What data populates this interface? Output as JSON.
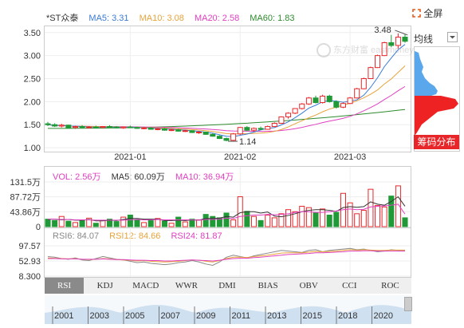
{
  "header": {
    "stock_name": "*ST众泰",
    "fullscreen_label": "全屏"
  },
  "legend_main": [
    {
      "label": "MA5: 3.31",
      "color": "#3a7bd5"
    },
    {
      "label": "MA10: 3.08",
      "color": "#e8a33a"
    },
    {
      "label": "MA20: 2.58",
      "color": "#e040c0"
    },
    {
      "label": "MA60: 1.83",
      "color": "#2e8b2e"
    }
  ],
  "legend_volume": [
    {
      "label": "VOL: 2.56万",
      "color": "#e040c0"
    },
    {
      "label": "MA5: 60.09万",
      "color": "#333333"
    },
    {
      "label": "MA10: 36.94万",
      "color": "#e040c0"
    }
  ],
  "legend_rsi": [
    {
      "label": "RSI6: 84.07",
      "color": "#888888"
    },
    {
      "label": "RSI12: 84.66",
      "color": "#e8a33a"
    },
    {
      "label": "RSI24: 81.87",
      "color": "#e040c0"
    }
  ],
  "right_panel": {
    "junxian_label": "均线",
    "chip_label": "筹码分布"
  },
  "watermark": "东方财富 eastmoney.com",
  "tabs": [
    "RSI",
    "KDJ",
    "MACD",
    "WWR",
    "DMI",
    "BIAS",
    "OBV",
    "CCI",
    "ROC"
  ],
  "active_tab": "RSI",
  "overview_years": [
    "2001",
    "2003",
    "2005",
    "2007",
    "2009",
    "2011",
    "2013",
    "2015",
    "2018",
    "2020"
  ],
  "colors": {
    "up": "#e8262a",
    "down": "#1f9a37",
    "ma5": "#3a7bd5",
    "ma10": "#e8a33a",
    "ma20": "#e040c0",
    "ma60": "#2e8b2e"
  },
  "chart_data": [
    {
      "type": "candlestick",
      "title": "*ST众泰",
      "y_ticks": [
        "3.50",
        "3.00",
        "2.50",
        "2.00",
        "1.50",
        "1.00"
      ],
      "ylim": [
        0.95,
        3.6
      ],
      "x_ticks": [
        "2021-01",
        "2021-02",
        "2021-03"
      ],
      "annotations": [
        "3.48",
        "1.14"
      ],
      "candles": [
        {
          "o": 1.52,
          "h": 1.56,
          "l": 1.47,
          "c": 1.5
        },
        {
          "o": 1.5,
          "h": 1.53,
          "l": 1.45,
          "c": 1.47
        },
        {
          "o": 1.47,
          "h": 1.52,
          "l": 1.44,
          "c": 1.49
        },
        {
          "o": 1.49,
          "h": 1.5,
          "l": 1.42,
          "c": 1.43
        },
        {
          "o": 1.44,
          "h": 1.48,
          "l": 1.41,
          "c": 1.46
        },
        {
          "o": 1.46,
          "h": 1.49,
          "l": 1.43,
          "c": 1.44
        },
        {
          "o": 1.44,
          "h": 1.47,
          "l": 1.42,
          "c": 1.45
        },
        {
          "o": 1.45,
          "h": 1.48,
          "l": 1.43,
          "c": 1.44
        },
        {
          "o": 1.44,
          "h": 1.47,
          "l": 1.42,
          "c": 1.46
        },
        {
          "o": 1.46,
          "h": 1.49,
          "l": 1.44,
          "c": 1.45
        },
        {
          "o": 1.45,
          "h": 1.47,
          "l": 1.42,
          "c": 1.43
        },
        {
          "o": 1.43,
          "h": 1.46,
          "l": 1.41,
          "c": 1.45
        },
        {
          "o": 1.45,
          "h": 1.48,
          "l": 1.43,
          "c": 1.44
        },
        {
          "o": 1.44,
          "h": 1.46,
          "l": 1.41,
          "c": 1.42
        },
        {
          "o": 1.42,
          "h": 1.45,
          "l": 1.4,
          "c": 1.43
        },
        {
          "o": 1.43,
          "h": 1.45,
          "l": 1.39,
          "c": 1.4
        },
        {
          "o": 1.4,
          "h": 1.43,
          "l": 1.38,
          "c": 1.41
        },
        {
          "o": 1.41,
          "h": 1.43,
          "l": 1.37,
          "c": 1.38
        },
        {
          "o": 1.38,
          "h": 1.41,
          "l": 1.36,
          "c": 1.39
        },
        {
          "o": 1.39,
          "h": 1.41,
          "l": 1.35,
          "c": 1.36
        },
        {
          "o": 1.36,
          "h": 1.39,
          "l": 1.34,
          "c": 1.37
        },
        {
          "o": 1.37,
          "h": 1.38,
          "l": 1.32,
          "c": 1.33
        },
        {
          "o": 1.33,
          "h": 1.36,
          "l": 1.3,
          "c": 1.34
        },
        {
          "o": 1.34,
          "h": 1.35,
          "l": 1.28,
          "c": 1.29
        },
        {
          "o": 1.29,
          "h": 1.31,
          "l": 1.24,
          "c": 1.25
        },
        {
          "o": 1.25,
          "h": 1.27,
          "l": 1.19,
          "c": 1.2
        },
        {
          "o": 1.2,
          "h": 1.22,
          "l": 1.14,
          "c": 1.16
        },
        {
          "o": 1.16,
          "h": 1.32,
          "l": 1.15,
          "c": 1.3
        },
        {
          "o": 1.3,
          "h": 1.45,
          "l": 1.28,
          "c": 1.44
        },
        {
          "o": 1.44,
          "h": 1.47,
          "l": 1.36,
          "c": 1.38
        },
        {
          "o": 1.38,
          "h": 1.44,
          "l": 1.35,
          "c": 1.42
        },
        {
          "o": 1.42,
          "h": 1.46,
          "l": 1.38,
          "c": 1.4
        },
        {
          "o": 1.4,
          "h": 1.48,
          "l": 1.39,
          "c": 1.46
        },
        {
          "o": 1.46,
          "h": 1.55,
          "l": 1.45,
          "c": 1.53
        },
        {
          "o": 1.53,
          "h": 1.68,
          "l": 1.52,
          "c": 1.67
        },
        {
          "o": 1.67,
          "h": 1.77,
          "l": 1.63,
          "c": 1.75
        },
        {
          "o": 1.75,
          "h": 1.86,
          "l": 1.73,
          "c": 1.85
        },
        {
          "o": 1.85,
          "h": 1.97,
          "l": 1.83,
          "c": 1.95
        },
        {
          "o": 1.95,
          "h": 2.1,
          "l": 1.93,
          "c": 2.08
        },
        {
          "o": 2.08,
          "h": 2.13,
          "l": 1.96,
          "c": 1.98
        },
        {
          "o": 1.98,
          "h": 2.15,
          "l": 1.96,
          "c": 2.12
        },
        {
          "o": 2.12,
          "h": 2.15,
          "l": 1.98,
          "c": 2.0
        },
        {
          "o": 2.0,
          "h": 2.03,
          "l": 1.85,
          "c": 1.88
        },
        {
          "o": 1.88,
          "h": 1.98,
          "l": 1.86,
          "c": 1.96
        },
        {
          "o": 1.96,
          "h": 2.1,
          "l": 1.95,
          "c": 2.08
        },
        {
          "o": 2.08,
          "h": 2.3,
          "l": 2.07,
          "c": 2.28
        },
        {
          "o": 2.28,
          "h": 2.52,
          "l": 2.27,
          "c": 2.5
        },
        {
          "o": 2.5,
          "h": 2.76,
          "l": 2.49,
          "c": 2.74
        },
        {
          "o": 2.74,
          "h": 3.02,
          "l": 2.73,
          "c": 3.0
        },
        {
          "o": 3.0,
          "h": 3.3,
          "l": 2.99,
          "c": 3.28
        },
        {
          "o": 3.28,
          "h": 3.45,
          "l": 3.18,
          "c": 3.22
        },
        {
          "o": 3.22,
          "h": 3.48,
          "l": 3.15,
          "c": 3.4
        },
        {
          "o": 3.4,
          "h": 3.46,
          "l": 3.28,
          "c": 3.31
        }
      ]
    },
    {
      "type": "bar",
      "title": "VOL",
      "y_ticks": [
        "131.5万",
        "87.72万",
        "43.86万",
        "0"
      ],
      "ylim": [
        0,
        131.5
      ],
      "values": [
        22,
        18,
        30,
        16,
        12,
        20,
        25,
        10,
        18,
        22,
        15,
        28,
        34,
        20,
        12,
        18,
        24,
        16,
        10,
        28,
        14,
        22,
        20,
        36,
        30,
        26,
        40,
        20,
        88,
        45,
        30,
        18,
        34,
        26,
        38,
        50,
        44,
        60,
        56,
        40,
        52,
        34,
        42,
        98,
        70,
        38,
        48,
        110,
        62,
        58,
        90,
        120,
        26
      ],
      "ma5": [
        22,
        22,
        20,
        21,
        19,
        19,
        21,
        17,
        17,
        19,
        18,
        21,
        24,
        24,
        22,
        22,
        22,
        18,
        18,
        19,
        18,
        20,
        19,
        24,
        24,
        25,
        30,
        28,
        41,
        44,
        44,
        40,
        43,
        31,
        29,
        33,
        38,
        44,
        48,
        50,
        50,
        48,
        45,
        56,
        59,
        57,
        59,
        73,
        66,
        63,
        74,
        88,
        60
      ],
      "ma10": [
        22,
        22,
        21,
        21,
        20,
        20,
        20,
        19,
        19,
        19,
        19,
        19,
        20,
        21,
        20,
        20,
        21,
        20,
        20,
        20,
        20,
        20,
        19,
        21,
        21,
        22,
        25,
        24,
        30,
        32,
        34,
        34,
        36,
        35,
        36,
        38,
        42,
        44,
        44,
        42,
        42,
        44,
        46,
        50,
        52,
        50,
        51,
        58,
        60,
        61,
        63,
        66,
        37
      ]
    },
    {
      "type": "line",
      "title": "RSI",
      "y_ticks": [
        "97.57",
        "52.93",
        "8.300"
      ],
      "ylim": [
        8.3,
        97.57
      ],
      "rsi6": [
        66,
        64,
        60,
        58,
        62,
        56,
        54,
        60,
        66,
        62,
        58,
        56,
        52,
        48,
        50,
        46,
        44,
        42,
        44,
        48,
        50,
        54,
        50,
        44,
        40,
        50,
        64,
        70,
        66,
        62,
        68,
        72,
        76,
        80,
        84,
        82,
        80,
        78,
        84,
        86,
        80,
        84,
        86,
        88,
        90,
        86,
        88,
        84,
        80,
        82,
        86,
        84,
        84
      ],
      "rsi12": [
        62,
        61,
        60,
        59,
        60,
        58,
        57,
        58,
        60,
        59,
        57,
        56,
        55,
        53,
        54,
        52,
        51,
        50,
        51,
        52,
        54,
        56,
        55,
        52,
        50,
        54,
        60,
        64,
        64,
        63,
        66,
        68,
        70,
        73,
        76,
        77,
        77,
        77,
        79,
        81,
        80,
        81,
        82,
        84,
        86,
        85,
        86,
        85,
        84,
        84,
        85,
        85,
        85
      ],
      "rsi24": [
        60,
        60,
        59,
        59,
        59,
        58,
        58,
        58,
        59,
        58,
        57,
        57,
        56,
        55,
        55,
        54,
        54,
        53,
        53,
        54,
        55,
        56,
        55,
        54,
        53,
        55,
        58,
        60,
        61,
        61,
        63,
        64,
        66,
        68,
        70,
        72,
        73,
        74,
        75,
        77,
        77,
        78,
        79,
        80,
        82,
        82,
        83,
        83,
        82,
        82,
        82,
        82,
        82
      ]
    }
  ]
}
